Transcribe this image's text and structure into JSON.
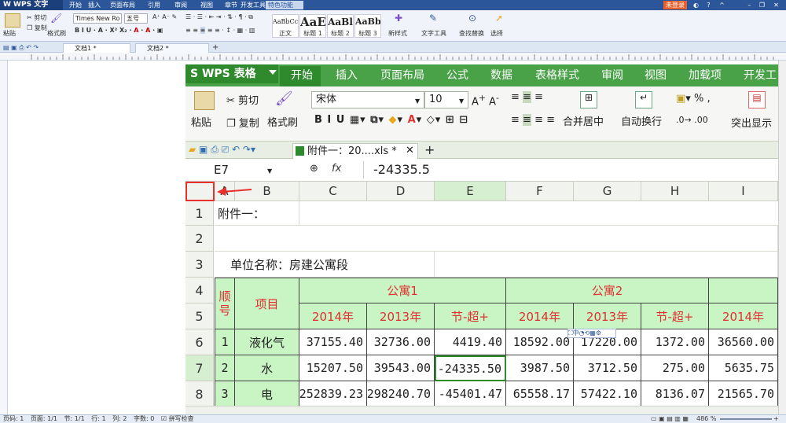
{
  "writer": {
    "app_title": "W WPS 文字",
    "menu_tabs": [
      "开始",
      "插入",
      "页面布局",
      "引用",
      "审阅",
      "视图",
      "章节",
      "开发工具"
    ],
    "special_tab": "特色功能",
    "login": "未登录",
    "ribbon": {
      "cut": "剪切",
      "copy": "复制",
      "paste": "粘贴",
      "format_painter": "格式刷",
      "font_name": "Times New Ro",
      "font_size": "五号",
      "styles": [
        {
          "sample": "AaBbCcDd",
          "label": "正文"
        },
        {
          "sample": "AaE",
          "label": "标题 1"
        },
        {
          "sample": "AaBl",
          "label": "标题 2"
        },
        {
          "sample": "AaBb",
          "label": "标题 3"
        }
      ],
      "new_style": "新样式",
      "text_tools": "文字工具",
      "find_replace": "查找替换",
      "select": "选择"
    },
    "doc_tabs": [
      "文档1 *",
      "文档2 *"
    ],
    "status": {
      "page_no": "页码: 1",
      "pages": "页面: 1/1",
      "section": "节: 1/1",
      "row": "行: 1",
      "col": "列: 2",
      "words": "字数: 0",
      "spell": "拼写检查",
      "zoom": "486 %"
    }
  },
  "et": {
    "logo": "S WPS 表格",
    "menu_tabs": [
      "开始",
      "插入",
      "页面布局",
      "公式",
      "数据",
      "表格样式",
      "审阅",
      "视图",
      "加载项",
      "开发工"
    ],
    "ribbon": {
      "cut": "剪切",
      "copy": "复制",
      "paste": "粘贴",
      "format_painter": "格式刷",
      "font_name": "宋体",
      "font_size": "10",
      "merge_center": "合并居中",
      "wrap": "自动换行",
      "highlight": "突出显示"
    },
    "file_tab": "附件一：20....xls *",
    "name_box": "E7",
    "formula": "-24335.5",
    "columns": [
      "A",
      "B",
      "C",
      "D",
      "E",
      "F",
      "G",
      "H",
      "I"
    ],
    "rows": [
      "1",
      "2",
      "3",
      "4",
      "5",
      "6",
      "7",
      "8"
    ],
    "cells": {
      "r1": "附件一：",
      "r3": "单位名称：房建公寓段",
      "seq_header": "顺号",
      "item_header": "项目",
      "group1": "公寓1",
      "group2": "公寓2",
      "year_2014": "2014年",
      "year_2013": "2013年",
      "diff": "节-超+",
      "data": [
        {
          "seq": "1",
          "item": "液化气",
          "c": "37155.40",
          "d": "32736.00",
          "e": "4419.40",
          "f": "18592.00",
          "g": "17220.00",
          "h": "1372.00",
          "i": "36560.00"
        },
        {
          "seq": "2",
          "item": "水",
          "c": "15207.50",
          "d": "39543.00",
          "e": "-24335.50",
          "f": "3987.50",
          "g": "3712.50",
          "h": "275.00",
          "i": "5635.75"
        },
        {
          "seq": "3",
          "item": "电",
          "c": "252839.23",
          "d": "298240.70",
          "e": "-45401.47",
          "f": "65558.17",
          "g": "57422.10",
          "h": "8136.07",
          "i": "21565.70"
        }
      ]
    }
  }
}
